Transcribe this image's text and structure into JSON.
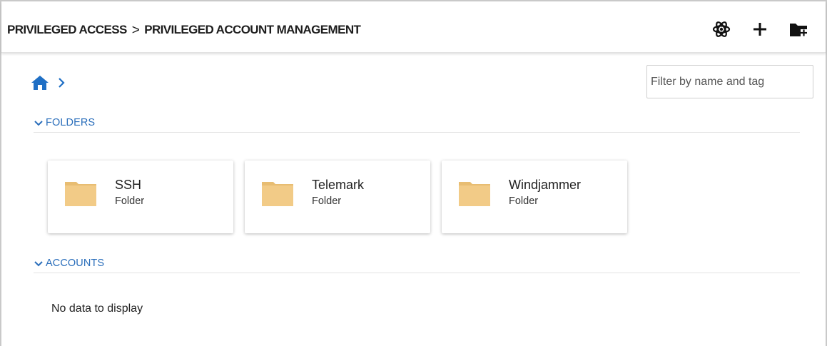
{
  "header": {
    "crumb1": "PRIVILEGED ACCESS",
    "separator": ">",
    "crumb2": "PRIVILEGED ACCOUNT MANAGEMENT",
    "actions": [
      {
        "icon": "atom-icon"
      },
      {
        "icon": "plus-icon"
      },
      {
        "icon": "folder-add-icon"
      }
    ]
  },
  "breadcrumb": {
    "home_icon": "home-icon",
    "chevron": "chevron-right-icon"
  },
  "filter": {
    "placeholder": "Filter by name and tag",
    "value": ""
  },
  "sections": {
    "folders": {
      "label": "FOLDERS"
    },
    "accounts": {
      "label": "ACCOUNTS",
      "empty_text": "No data to display"
    }
  },
  "folders": [
    {
      "name": "SSH",
      "type": "Folder"
    },
    {
      "name": "Telemark",
      "type": "Folder"
    },
    {
      "name": "Windjammer",
      "type": "Folder"
    }
  ],
  "colors": {
    "accent": "#2a6ebb",
    "home": "#1f6fc5",
    "folder": "#f2cb87",
    "folder_tab": "#e8bd72"
  }
}
